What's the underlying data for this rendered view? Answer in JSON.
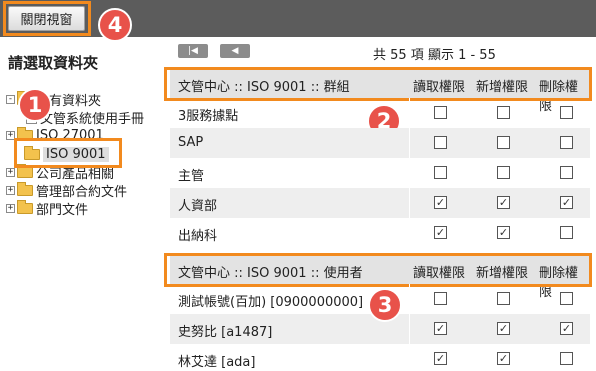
{
  "toolbar": {
    "close_label": "關閉視窗"
  },
  "callouts": [
    "1",
    "2",
    "3",
    "4"
  ],
  "colors": {
    "callout": "#e8524a",
    "highlight_box": "#f28a1e",
    "topbar": "#5c5c5c"
  },
  "tree": {
    "title": "請選取資料夾",
    "items": [
      {
        "label": "所有資料夾",
        "icon": "folder-icon",
        "expander": "-"
      },
      {
        "label": "文管系統使用手冊",
        "icon": "document-icon",
        "expander": ""
      },
      {
        "label": "ISO 27001",
        "icon": "folder-icon",
        "expander": "+"
      },
      {
        "label": "ISO 9001",
        "icon": "folder-icon",
        "expander": "",
        "selected": true
      },
      {
        "label": "公司產品相關",
        "icon": "folder-icon",
        "expander": "+"
      },
      {
        "label": "管理部合約文件",
        "icon": "folder-icon",
        "expander": "+"
      },
      {
        "label": "部門文件",
        "icon": "folder-icon",
        "expander": "+"
      }
    ]
  },
  "pager": {
    "first_icon": "first-page-icon",
    "prev_icon": "prev-page-icon",
    "info": "共 55 項 顯示 1 - 55"
  },
  "group_table": {
    "header": {
      "name": "文管中心 :: ISO 9001 :: 群組",
      "read": "讀取權限",
      "add": "新增權限",
      "delete": "刪除權限"
    },
    "rows": [
      {
        "name": "3服務據點",
        "read": false,
        "add": false,
        "delete": false
      },
      {
        "name": "SAP",
        "read": false,
        "add": false,
        "delete": false
      },
      {
        "name": "主管",
        "read": false,
        "add": false,
        "delete": false
      },
      {
        "name": "人資部",
        "read": true,
        "add": true,
        "delete": true
      },
      {
        "name": "出納科",
        "read": true,
        "add": true,
        "delete": false
      }
    ]
  },
  "user_table": {
    "header": {
      "name": "文管中心 :: ISO 9001 :: 使用者",
      "read": "讀取權限",
      "add": "新增權限",
      "delete": "刪除權限"
    },
    "rows": [
      {
        "name": "測試帳號(百加) [0900000000]",
        "read": false,
        "add": false,
        "delete": false
      },
      {
        "name": "史努比 [a1487]",
        "read": true,
        "add": true,
        "delete": true
      },
      {
        "name": "林艾達 [ada]",
        "read": true,
        "add": true,
        "delete": false
      }
    ]
  }
}
